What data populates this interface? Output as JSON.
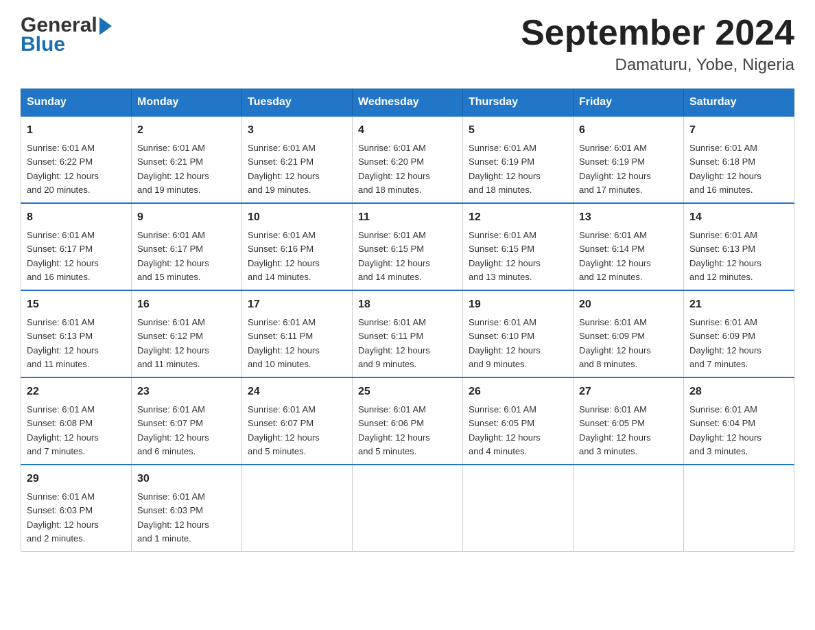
{
  "header": {
    "title": "September 2024",
    "subtitle": "Damaturu, Yobe, Nigeria",
    "logo_general": "General",
    "logo_blue": "Blue"
  },
  "columns": [
    "Sunday",
    "Monday",
    "Tuesday",
    "Wednesday",
    "Thursday",
    "Friday",
    "Saturday"
  ],
  "weeks": [
    [
      {
        "day": "1",
        "sunrise": "6:01 AM",
        "sunset": "6:22 PM",
        "daylight": "12 hours and 20 minutes."
      },
      {
        "day": "2",
        "sunrise": "6:01 AM",
        "sunset": "6:21 PM",
        "daylight": "12 hours and 19 minutes."
      },
      {
        "day": "3",
        "sunrise": "6:01 AM",
        "sunset": "6:21 PM",
        "daylight": "12 hours and 19 minutes."
      },
      {
        "day": "4",
        "sunrise": "6:01 AM",
        "sunset": "6:20 PM",
        "daylight": "12 hours and 18 minutes."
      },
      {
        "day": "5",
        "sunrise": "6:01 AM",
        "sunset": "6:19 PM",
        "daylight": "12 hours and 18 minutes."
      },
      {
        "day": "6",
        "sunrise": "6:01 AM",
        "sunset": "6:19 PM",
        "daylight": "12 hours and 17 minutes."
      },
      {
        "day": "7",
        "sunrise": "6:01 AM",
        "sunset": "6:18 PM",
        "daylight": "12 hours and 16 minutes."
      }
    ],
    [
      {
        "day": "8",
        "sunrise": "6:01 AM",
        "sunset": "6:17 PM",
        "daylight": "12 hours and 16 minutes."
      },
      {
        "day": "9",
        "sunrise": "6:01 AM",
        "sunset": "6:17 PM",
        "daylight": "12 hours and 15 minutes."
      },
      {
        "day": "10",
        "sunrise": "6:01 AM",
        "sunset": "6:16 PM",
        "daylight": "12 hours and 14 minutes."
      },
      {
        "day": "11",
        "sunrise": "6:01 AM",
        "sunset": "6:15 PM",
        "daylight": "12 hours and 14 minutes."
      },
      {
        "day": "12",
        "sunrise": "6:01 AM",
        "sunset": "6:15 PM",
        "daylight": "12 hours and 13 minutes."
      },
      {
        "day": "13",
        "sunrise": "6:01 AM",
        "sunset": "6:14 PM",
        "daylight": "12 hours and 12 minutes."
      },
      {
        "day": "14",
        "sunrise": "6:01 AM",
        "sunset": "6:13 PM",
        "daylight": "12 hours and 12 minutes."
      }
    ],
    [
      {
        "day": "15",
        "sunrise": "6:01 AM",
        "sunset": "6:13 PM",
        "daylight": "12 hours and 11 minutes."
      },
      {
        "day": "16",
        "sunrise": "6:01 AM",
        "sunset": "6:12 PM",
        "daylight": "12 hours and 11 minutes."
      },
      {
        "day": "17",
        "sunrise": "6:01 AM",
        "sunset": "6:11 PM",
        "daylight": "12 hours and 10 minutes."
      },
      {
        "day": "18",
        "sunrise": "6:01 AM",
        "sunset": "6:11 PM",
        "daylight": "12 hours and 9 minutes."
      },
      {
        "day": "19",
        "sunrise": "6:01 AM",
        "sunset": "6:10 PM",
        "daylight": "12 hours and 9 minutes."
      },
      {
        "day": "20",
        "sunrise": "6:01 AM",
        "sunset": "6:09 PM",
        "daylight": "12 hours and 8 minutes."
      },
      {
        "day": "21",
        "sunrise": "6:01 AM",
        "sunset": "6:09 PM",
        "daylight": "12 hours and 7 minutes."
      }
    ],
    [
      {
        "day": "22",
        "sunrise": "6:01 AM",
        "sunset": "6:08 PM",
        "daylight": "12 hours and 7 minutes."
      },
      {
        "day": "23",
        "sunrise": "6:01 AM",
        "sunset": "6:07 PM",
        "daylight": "12 hours and 6 minutes."
      },
      {
        "day": "24",
        "sunrise": "6:01 AM",
        "sunset": "6:07 PM",
        "daylight": "12 hours and 5 minutes."
      },
      {
        "day": "25",
        "sunrise": "6:01 AM",
        "sunset": "6:06 PM",
        "daylight": "12 hours and 5 minutes."
      },
      {
        "day": "26",
        "sunrise": "6:01 AM",
        "sunset": "6:05 PM",
        "daylight": "12 hours and 4 minutes."
      },
      {
        "day": "27",
        "sunrise": "6:01 AM",
        "sunset": "6:05 PM",
        "daylight": "12 hours and 3 minutes."
      },
      {
        "day": "28",
        "sunrise": "6:01 AM",
        "sunset": "6:04 PM",
        "daylight": "12 hours and 3 minutes."
      }
    ],
    [
      {
        "day": "29",
        "sunrise": "6:01 AM",
        "sunset": "6:03 PM",
        "daylight": "12 hours and 2 minutes."
      },
      {
        "day": "30",
        "sunrise": "6:01 AM",
        "sunset": "6:03 PM",
        "daylight": "12 hours and 1 minute."
      },
      null,
      null,
      null,
      null,
      null
    ]
  ],
  "labels": {
    "sunrise_prefix": "Sunrise: ",
    "sunset_prefix": "Sunset: ",
    "daylight_prefix": "Daylight: "
  }
}
